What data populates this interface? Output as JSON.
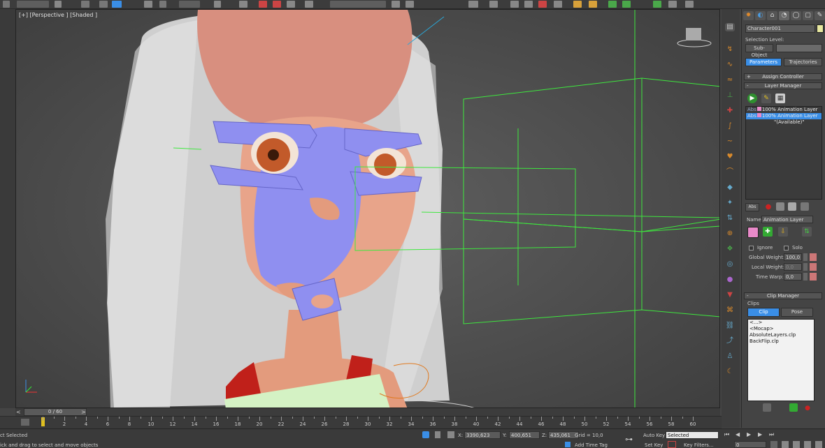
{
  "viewport": {
    "label": "[+] [Perspective ] [Shaded ]"
  },
  "command_panel": {
    "tabs": [
      "create-icon",
      "modify-icon",
      "hierarchy-icon",
      "motion-icon",
      "display-icon",
      "utilities-icon"
    ],
    "object_name": "Character001",
    "selection_level_label": "Selection Level:",
    "sub_object_label": "Sub-Object",
    "parameters_tab": "Parameters",
    "trajectories_tab": "Trajectories",
    "assign_controller": "Assign Controller",
    "layer_manager": "Layer Manager",
    "layers": [
      {
        "prefix": "Abs",
        "label": "100% Animation Layer",
        "selected": false
      },
      {
        "prefix": "Abs",
        "label": "100% Animation Layer",
        "selected": true
      },
      {
        "prefix": "",
        "label": "\"(Available)\"",
        "selected": false
      }
    ],
    "layer_abs_label": "Abs",
    "name_label": "Name:",
    "name_value": "Animation Layer",
    "ignore_label": "Ignore",
    "solo_label": "Solo",
    "global_weight_label": "Global Weight:",
    "global_weight_value": "100,0",
    "local_weight_label": "Local Weight:",
    "local_weight_value": "0,0",
    "time_warp_label": "Time Warp:",
    "time_warp_value": "0,0",
    "clip_manager": "Clip Manager",
    "clips_label": "Clips",
    "clip_tab": "Clip",
    "pose_tab": "Pose",
    "clips": [
      "<...>",
      "<Mocap>",
      "AbsoluteLayers.clp",
      "BackFlip.clp"
    ]
  },
  "timeline": {
    "frame_display": "0 / 60",
    "prev_arrow": "<",
    "next_arrow": ">",
    "ticks": [
      "2",
      "4",
      "6",
      "8",
      "10",
      "12",
      "14",
      "16",
      "18",
      "20",
      "22",
      "24",
      "26",
      "28",
      "30",
      "32",
      "34",
      "36",
      "38",
      "40",
      "42",
      "44",
      "46",
      "48",
      "50",
      "52",
      "54",
      "56",
      "58",
      "60"
    ],
    "current_frame": 0
  },
  "status": {
    "selection_text": "ct Selected",
    "prompt_text": "ick and drag to select and move objects",
    "x_label": "X:",
    "x_value": "3390,623",
    "y_label": "Y:",
    "y_value": "400,651",
    "z_label": "Z:",
    "z_value": "435,061",
    "grid_text": "Grid = 10,0",
    "add_time_tag": "Add Time Tag",
    "auto_key": "Auto Key",
    "auto_key_select": "Selected",
    "set_key": "Set Key",
    "key_filters": "Key Filters...",
    "frame_field": "0"
  },
  "colors": {
    "accent_blue": "#3a8ee6",
    "wireframe_green": "#3ee83e",
    "skin": "#e39b7d",
    "mask_blue": "#8f8ff0",
    "hair": "#d8d8d8",
    "layer_pink": "#e98ac9"
  }
}
